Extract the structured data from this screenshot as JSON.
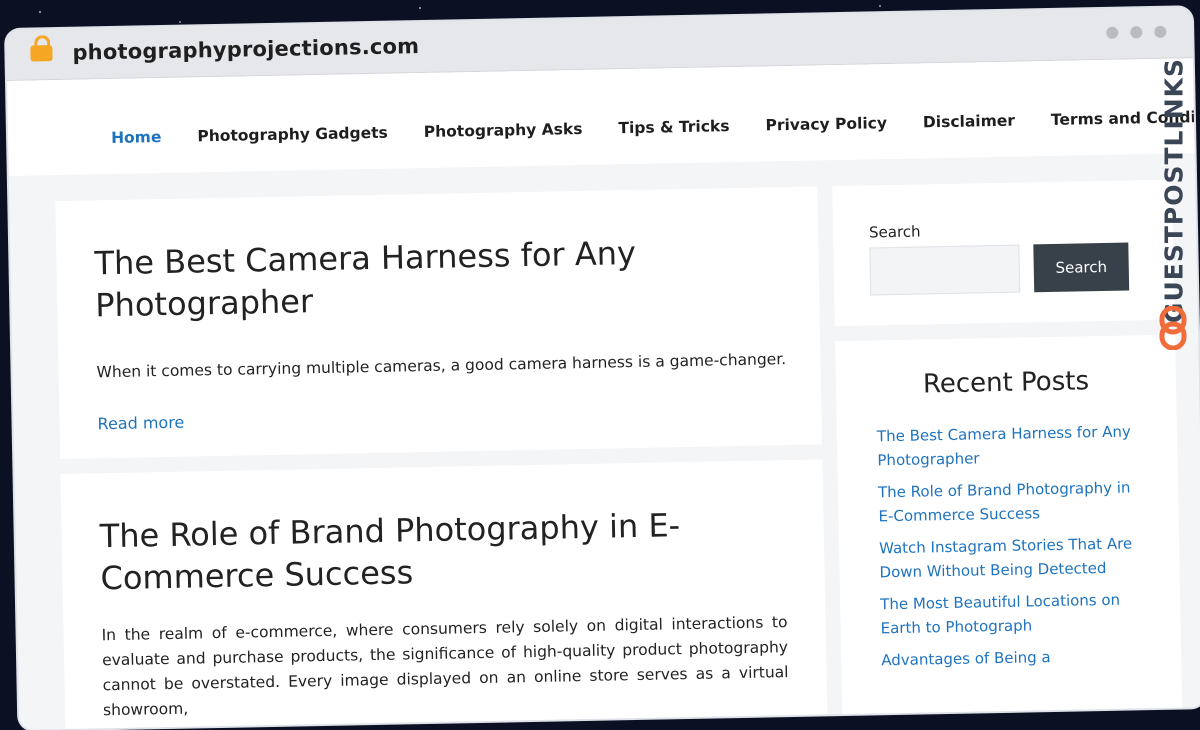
{
  "browser": {
    "url": "photographyprojections.com"
  },
  "nav": {
    "items": [
      {
        "label": "Home",
        "active": true
      },
      {
        "label": "Photography Gadgets",
        "active": false
      },
      {
        "label": "Photography Asks",
        "active": false
      },
      {
        "label": "Tips & Tricks",
        "active": false
      },
      {
        "label": "Privacy Policy",
        "active": false
      },
      {
        "label": "Disclaimer",
        "active": false
      },
      {
        "label": "Terms and Conditions",
        "active": false
      }
    ]
  },
  "posts": [
    {
      "title": "The Best Camera Harness for Any Photographer",
      "excerpt": "When it comes to carrying multiple cameras, a good camera harness is a game-changer.",
      "read_more": "Read more"
    },
    {
      "title": "The Role of Brand Photography in E-Commerce Success",
      "body": "In the realm of e-commerce, where consumers rely solely on digital interactions to evaluate and purchase products, the significance of high-quality product photography cannot be overstated. Every image displayed on an online store serves as a virtual showroom,"
    }
  ],
  "sidebar": {
    "search_label": "Search",
    "search_button": "Search",
    "recent_title": "Recent Posts",
    "recent_posts": [
      "The Best Camera Harness for Any Photographer",
      "The Role of Brand Photography in E-Commerce Success",
      "Watch Instagram Stories That Are Down Without Being Detected",
      "The Most Beautiful Locations on Earth to Photograph",
      "Advantages of Being a"
    ]
  },
  "watermark": {
    "text": "GUESTPOSTLINKS"
  },
  "colors": {
    "link": "#1e73be",
    "accent_lock": "#f5a623",
    "button": "#38414a",
    "watermark_icon": "#f26b3a"
  }
}
